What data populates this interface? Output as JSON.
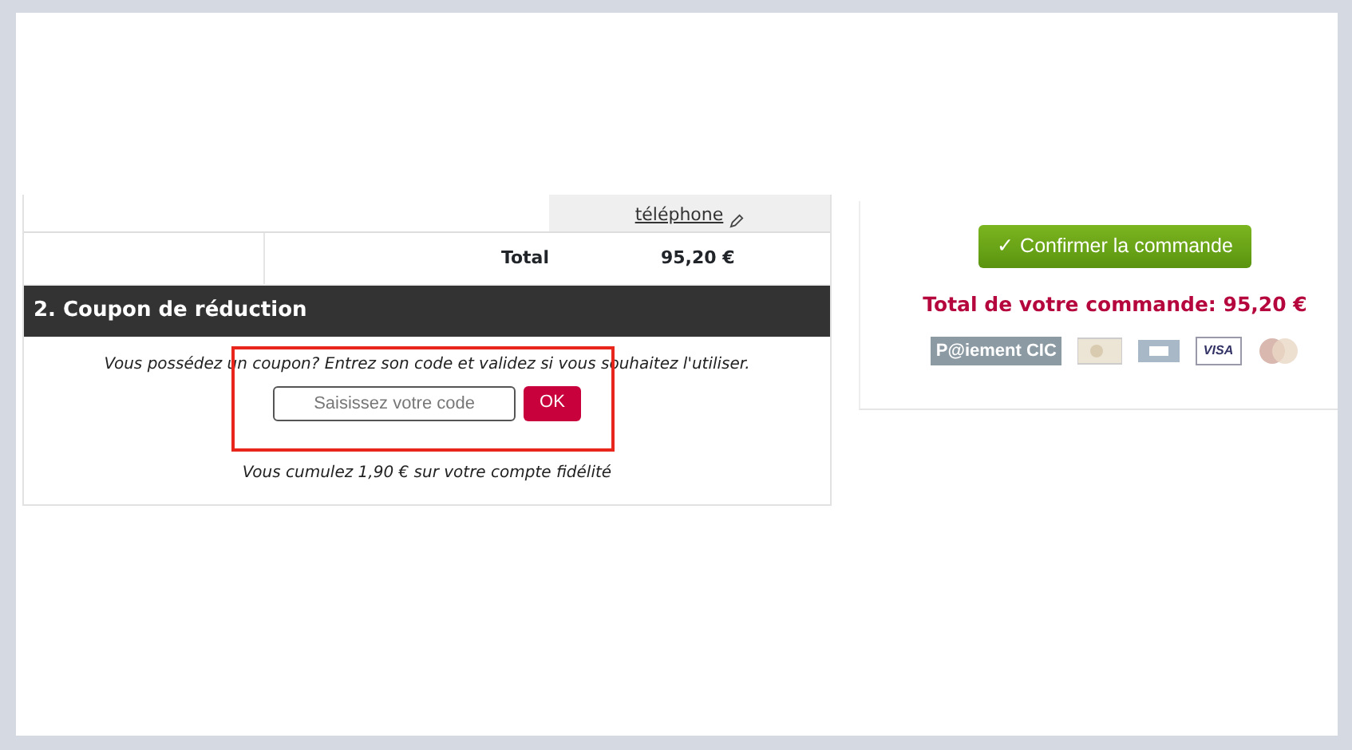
{
  "cart": {
    "phone_link": "téléphone",
    "total_label": "Total",
    "total_value": "95,20 €"
  },
  "coupon": {
    "title": "2. Coupon de réduction",
    "intro": "Vous possédez un coupon? Entrez son code et validez si vous souhaitez l'utiliser.",
    "placeholder": "Saisissez votre code",
    "button": "OK",
    "highlighted": true,
    "loyalty": "Vous cumulez 1,90 € sur votre compte fidélité"
  },
  "summary": {
    "confirm_button": "Confirmer la commande",
    "confirm_icon": "✓",
    "order_total": "Total de votre commande: 95,20 €",
    "cic_logo": "P@iement CIC",
    "visa_logo": "VISA"
  }
}
